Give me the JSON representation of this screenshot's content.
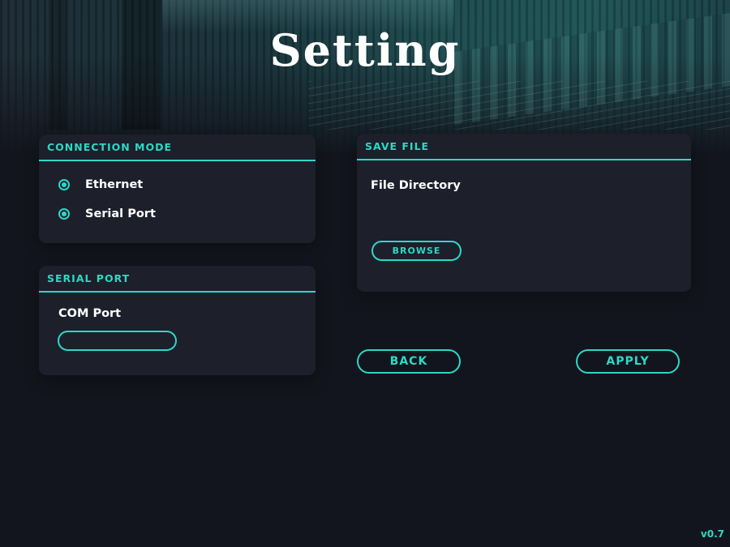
{
  "page": {
    "title": "Setting",
    "version": "v0.7"
  },
  "connection_mode": {
    "header": "CONNECTION MODE",
    "options": [
      {
        "label": "Ethernet",
        "selected": true
      },
      {
        "label": "Serial Port",
        "selected": true
      }
    ]
  },
  "serial_port": {
    "header": "SERIAL PORT",
    "com_label": "COM Port",
    "com_value": "",
    "com_placeholder": ""
  },
  "save_file": {
    "header": "SAVE FILE",
    "directory_label": "File Directory",
    "browse_label": "BROWSE"
  },
  "actions": {
    "back_label": "BACK",
    "apply_label": "APPLY"
  },
  "colors": {
    "accent": "#2bd9c5",
    "background": "#13151e",
    "panel": "#1d1f2b",
    "text": "#ffffff"
  },
  "icons": {
    "radio": "radio-selected-icon"
  }
}
